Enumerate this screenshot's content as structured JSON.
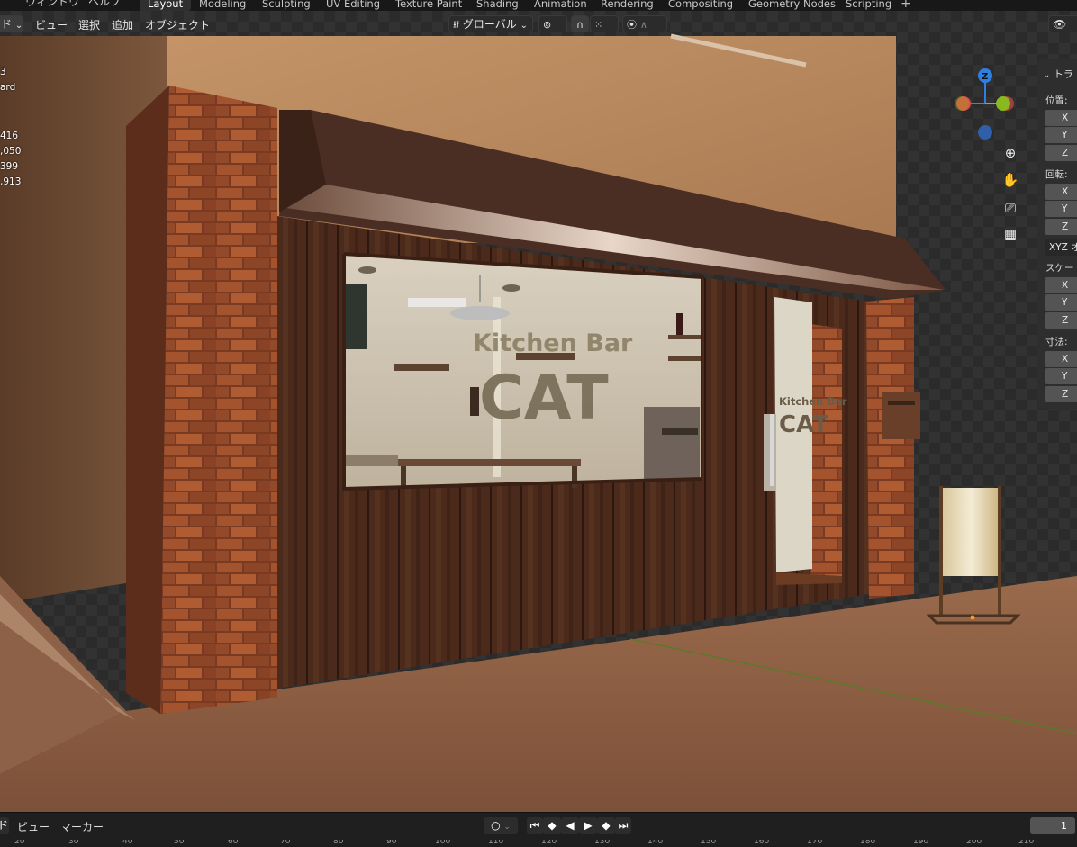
{
  "topbar": {
    "menus": [
      "ウィンドウ",
      "ヘルプ"
    ],
    "workspaces": [
      "Layout",
      "Modeling",
      "Sculpting",
      "UV Editing",
      "Texture Paint",
      "Shading",
      "Animation",
      "Rendering",
      "Compositing",
      "Geometry Nodes",
      "Scripting"
    ],
    "active_workspace": "Layout",
    "add_tab": "+"
  },
  "viewport_header": {
    "mode_fragment": "ド",
    "menus": [
      "ビュー",
      "選択",
      "追加",
      "オブジェクト"
    ],
    "orientation": "グローバル",
    "dropdown_arrow": "⌄"
  },
  "stats": {
    "lines": [
      "3",
      "ard",
      "",
      "416",
      ",050",
      "399",
      ",913"
    ]
  },
  "gizmo": {
    "z_label": "Z",
    "colors": {
      "x": "#e44a4a",
      "y": "#8ab820",
      "z": "#2f7fe0"
    }
  },
  "nav_icons": [
    "zoom-in-icon",
    "hand-pan-icon",
    "camera-icon",
    "perspective-grid-icon"
  ],
  "n_panel": {
    "title": "トラ",
    "location_label": "位置:",
    "rotation_label": "回転:",
    "rotation_mode": "XYZ オ",
    "scale_label": "スケー",
    "dimensions_label": "寸法:",
    "axes": [
      "X",
      "Y",
      "Z"
    ]
  },
  "scene": {
    "sign_line1": "Kitchen Bar",
    "sign_line2": "CAT",
    "door_line1": "Kitchen Bar",
    "door_line2": "CAT"
  },
  "timeline": {
    "mode_fragment": "ド",
    "menus": [
      "ビュー",
      "マーカー"
    ],
    "current_frame": "1",
    "ruler_ticks": [
      "20",
      "30",
      "40",
      "50",
      "60",
      "70",
      "80",
      "90",
      "100",
      "110",
      "120",
      "130",
      "140",
      "150",
      "160",
      "170",
      "180",
      "190",
      "200",
      "210"
    ]
  },
  "colors": {
    "accent": "#4772b3",
    "brick": "#8a4326",
    "wood": "#4a2a1a",
    "wall": "#c79a6e"
  }
}
